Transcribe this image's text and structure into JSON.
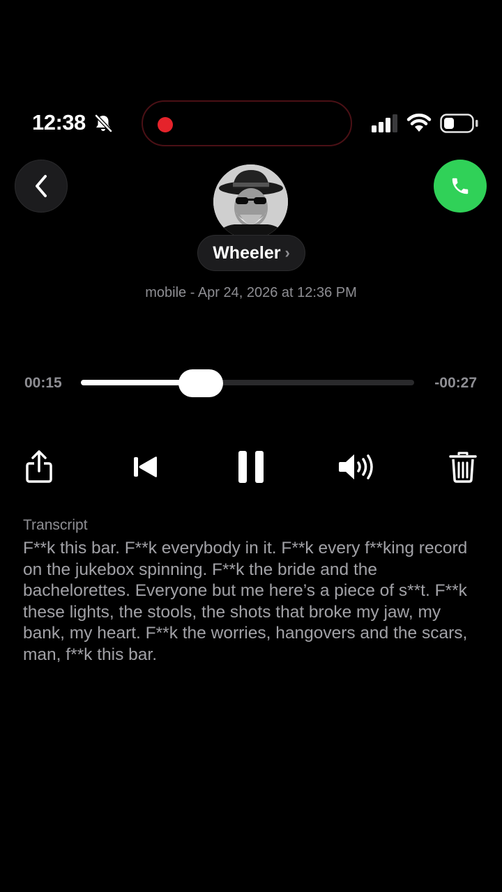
{
  "status_bar": {
    "time": "12:38",
    "icons": [
      "bell-slash-icon",
      "recording-dot",
      "cellular-signal-icon",
      "wifi-icon",
      "battery-icon"
    ],
    "recording_color": "#e5232b"
  },
  "header": {
    "back_icon": "chevron-left-icon",
    "call_icon": "phone-icon",
    "call_color": "#30d158",
    "contact_name": "Wheeler",
    "name_chevron": "›",
    "subtitle": "mobile - Apr 24, 2026 at 12:36 PM"
  },
  "player": {
    "elapsed": "00:15",
    "remaining": "-00:27",
    "progress": 0.36,
    "controls": [
      "share-icon",
      "skip-back-icon",
      "pause-icon",
      "speaker-icon",
      "trash-icon"
    ]
  },
  "transcript": {
    "label": "Transcript",
    "text": "F**k this bar. F**k everybody in it. F**k every f**king record on the jukebox spinning. F**k the bride and the bachelorettes. Everyone but me here’s a piece of s**t. F**k these lights, the stools, the shots that broke my jaw, my bank, my heart. F**k the worries, hangovers and the scars, man, f**k this bar."
  }
}
